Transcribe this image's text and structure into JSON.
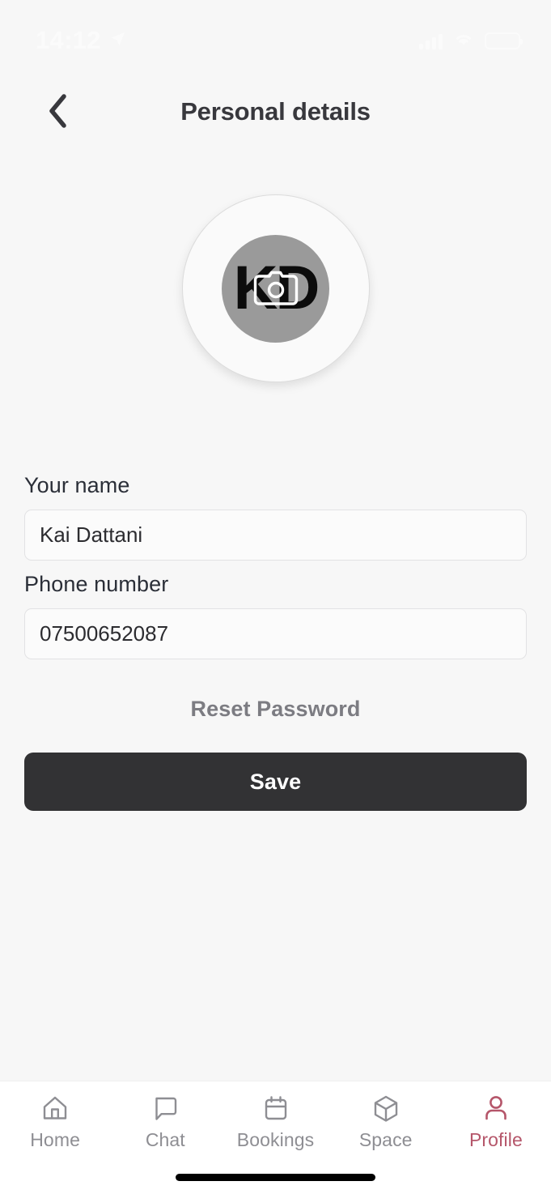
{
  "status_bar": {
    "time": "14:12",
    "location_icon": "location-arrow-icon",
    "signal_icon": "cellular-signal-icon",
    "wifi_icon": "wifi-icon",
    "battery_icon": "battery-icon",
    "battery_color": "#fcd116",
    "status_text_color": "#fbfbfb"
  },
  "header": {
    "back_icon": "chevron-left-icon",
    "title": "Personal details"
  },
  "avatar": {
    "initials": "KD",
    "camera_icon": "camera-icon",
    "ring_color": "#dcdcdc",
    "inner_color": "#9a9a9a"
  },
  "form": {
    "fields": [
      {
        "label": "Your name",
        "value": "Kai Dattani",
        "placeholder": "Your name"
      },
      {
        "label": "Phone number",
        "value": "07500652087",
        "placeholder": "Phone number"
      }
    ],
    "reset_password_label": "Reset Password",
    "save_label": "Save",
    "save_color": "#323234"
  },
  "tab_bar": {
    "active_color": "#b5566a",
    "inactive_color": "#8e8e93",
    "items": [
      {
        "label": "Home",
        "icon": "home-icon",
        "active": false
      },
      {
        "label": "Chat",
        "icon": "chat-bubble-icon",
        "active": false
      },
      {
        "label": "Bookings",
        "icon": "calendar-icon",
        "active": false
      },
      {
        "label": "Space",
        "icon": "cube-icon",
        "active": false
      },
      {
        "label": "Profile",
        "icon": "person-icon",
        "active": true
      }
    ]
  }
}
